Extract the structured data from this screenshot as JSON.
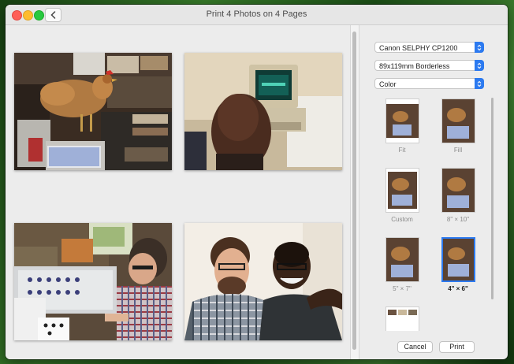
{
  "window": {
    "title": "Print 4 Photos on 4 Pages"
  },
  "icons": {
    "back": "chevron-left-icon",
    "dropdown": "chevron-updown-icon"
  },
  "settings": {
    "printer": "Canon SELPHY CP1200",
    "paper_size": "89x119mm Borderless",
    "color_mode": "Color"
  },
  "size_options": [
    {
      "label": "Fit",
      "selected": false
    },
    {
      "label": "Fill",
      "selected": false
    },
    {
      "label": "Custom",
      "selected": false
    },
    {
      "label": "8\" × 10\"",
      "selected": false
    },
    {
      "label": "5\" × 7\"",
      "selected": false
    },
    {
      "label": "4\" × 6\"",
      "selected": true
    }
  ],
  "buttons": {
    "cancel": "Cancel",
    "print": "Print"
  },
  "colors": {
    "accent": "#2c7af0",
    "window_bg": "#ececec"
  }
}
